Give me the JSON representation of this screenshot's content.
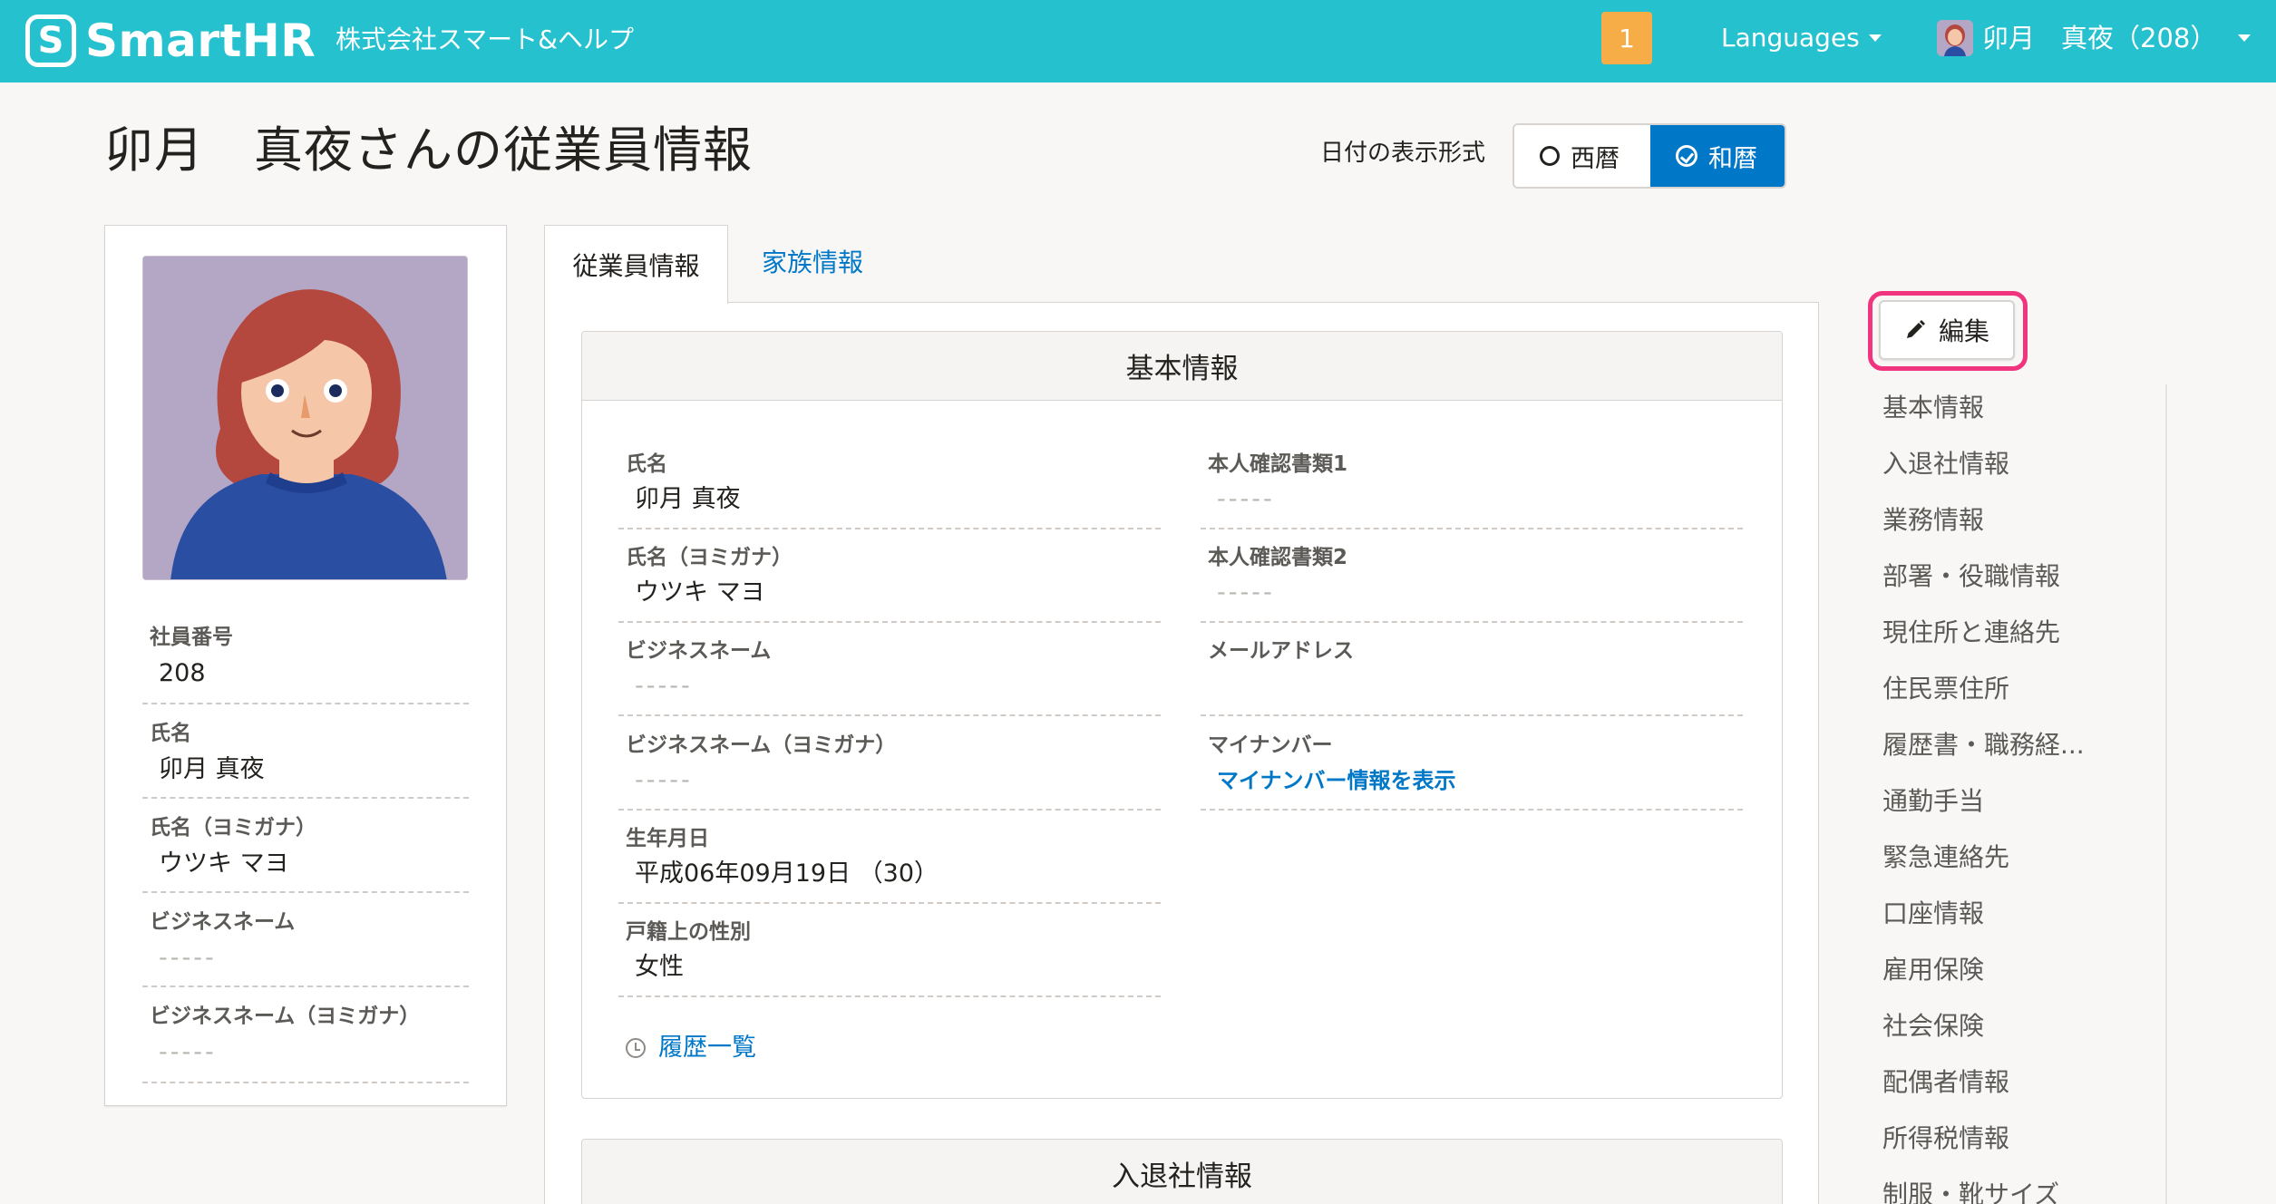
{
  "header": {
    "logo_mark": "S",
    "logo_text": "SmartHR",
    "company": "株式会社スマート&ヘルプ",
    "notification_count": "1",
    "languages_label": "Languages",
    "user_label": "卯月　真夜（208）"
  },
  "page": {
    "title": "卯月　真夜さんの従業員情報",
    "date_format_label": "日付の表示形式",
    "date_options": [
      "西暦",
      "和暦"
    ],
    "date_selected": "和暦"
  },
  "profile": {
    "fields": [
      {
        "label": "社員番号",
        "value": "208"
      },
      {
        "label": "氏名",
        "value": "卯月 真夜"
      },
      {
        "label": "氏名（ヨミガナ）",
        "value": "ウツキ マヨ"
      },
      {
        "label": "ビジネスネーム",
        "value": "-----"
      },
      {
        "label": "ビジネスネーム（ヨミガナ）",
        "value": "-----"
      }
    ]
  },
  "tabs": [
    {
      "label": "従業員情報",
      "active": true
    },
    {
      "label": "家族情報",
      "active": false
    }
  ],
  "basic_info": {
    "title": "基本情報",
    "left_fields": [
      {
        "label": "氏名",
        "value": "卯月 真夜"
      },
      {
        "label": "氏名（ヨミガナ）",
        "value": "ウツキ マヨ"
      },
      {
        "label": "ビジネスネーム",
        "value": "-----"
      },
      {
        "label": "ビジネスネーム（ヨミガナ）",
        "value": "-----"
      },
      {
        "label": "生年月日",
        "value": "平成06年09月19日 （30）"
      },
      {
        "label": "戸籍上の性別",
        "value": "女性"
      }
    ],
    "right_fields": [
      {
        "label": "本人確認書類1",
        "value": "-----"
      },
      {
        "label": "本人確認書類2",
        "value": "-----"
      },
      {
        "label": "メールアドレス",
        "value": ""
      },
      {
        "label": "マイナンバー",
        "value": "マイナンバー情報を表示"
      }
    ],
    "history_link": "履歴一覧"
  },
  "next_section": {
    "title": "入退社情報"
  },
  "side_nav": {
    "edit_label": "編集",
    "items": [
      "基本情報",
      "入退社情報",
      "業務情報",
      "部署・役職情報",
      "現住所と連絡先",
      "住民票住所",
      "履歴書・職務経...",
      "通勤手当",
      "緊急連絡先",
      "口座情報",
      "雇用保険",
      "社会保険",
      "配偶者情報",
      "所得税情報",
      "制服・靴サイズ"
    ]
  },
  "colors": {
    "header": "#25c1ce",
    "accent": "#0077c7",
    "badge": "#f7ad47",
    "highlight": "#f0347e"
  }
}
